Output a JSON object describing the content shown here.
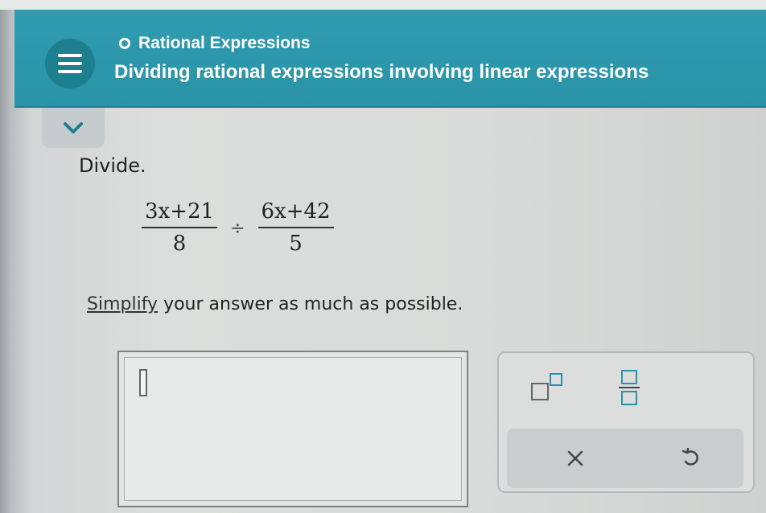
{
  "header": {
    "topic": "Rational Expressions",
    "title": "Dividing rational expressions involving linear expressions"
  },
  "problem": {
    "instruction": "Divide.",
    "expression": {
      "left_numerator": "3x+21",
      "left_denominator": "8",
      "operator": "÷",
      "right_numerator": "6x+42",
      "right_denominator": "5"
    },
    "prompt_link": "Simplify",
    "prompt_rest": " your answer as much as possible."
  },
  "answer": {
    "value": ""
  },
  "toolbox": {
    "buttons": [
      {
        "icon": "superscript-template-icon"
      },
      {
        "icon": "fraction-template-icon"
      },
      {
        "icon": "clear-x-icon",
        "label": "×"
      },
      {
        "icon": "undo-icon"
      }
    ]
  },
  "colors": {
    "header_teal": "#2f9cb0",
    "menu_circle": "#1e7f8f",
    "text": "#222222"
  }
}
